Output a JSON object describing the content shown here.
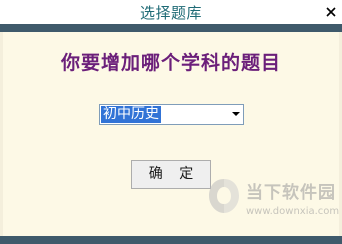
{
  "window": {
    "title": "选择题库",
    "close_icon": "close-icon"
  },
  "dialog": {
    "heading": "你要增加哪个学科的题目",
    "subject_select": {
      "value": "初中历史",
      "icon": "chevron-down-icon"
    },
    "confirm_label": "确 定"
  },
  "watermark": {
    "text": "当下软件园",
    "url": "www.downxia.com"
  },
  "colors": {
    "title_text": "#1f6b76",
    "heading_text": "#6b1f7a",
    "band": "#3f5a6b",
    "background": "#fdf9e6",
    "selection": "#3173d6"
  }
}
